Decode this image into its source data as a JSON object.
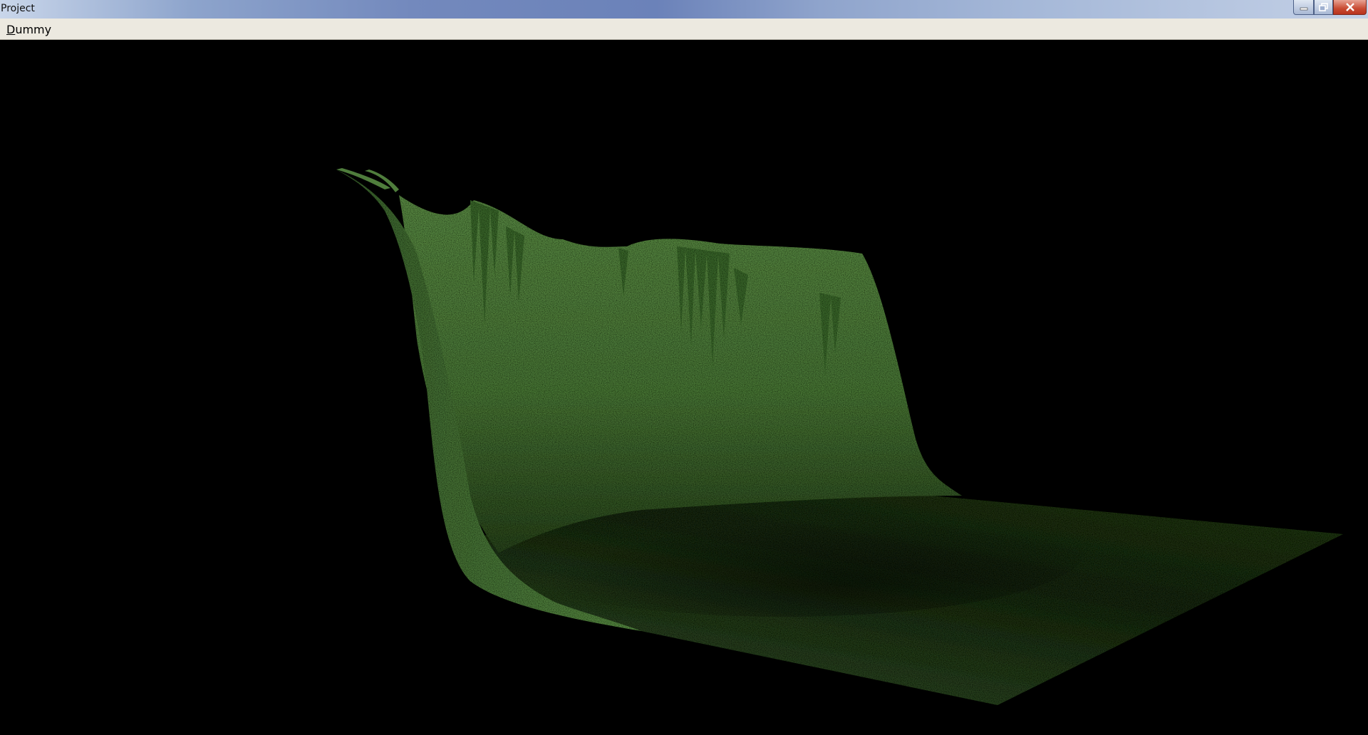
{
  "window": {
    "title": "Project",
    "controls": {
      "minimize_icon": "minimize-icon",
      "maximize_icon": "restore-icon",
      "close_icon": "close-icon"
    }
  },
  "menubar": {
    "items": [
      {
        "label_accel": "D",
        "label_rest": "ummy"
      }
    ]
  },
  "viewport": {
    "content": "3d-terrain",
    "colors": {
      "background": "#000000",
      "terrain_light": "#5a8a44",
      "terrain_mid": "#3f6a2e",
      "terrain_dark": "#1a2a12"
    }
  }
}
